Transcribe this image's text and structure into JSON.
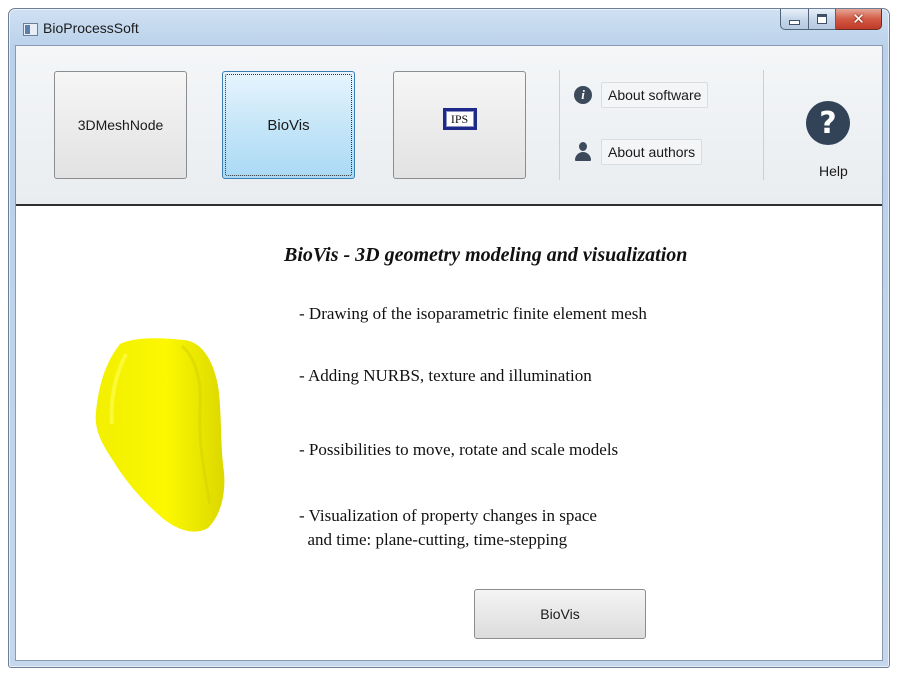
{
  "window": {
    "title": "BioProcessSoft"
  },
  "toolbar": {
    "mesh_label": "3DMeshNode",
    "biovis_label": "BioVis",
    "ips_logo_text": "IPS",
    "about_software_label": "About software",
    "about_authors_label": "About authors",
    "help_label": "Help",
    "help_glyph": "?"
  },
  "content": {
    "headline": "BioVis - 3D geometry modeling and visualization",
    "features": [
      "- Drawing of the isoparametric finite element mesh",
      "- Adding NURBS, texture and illumination",
      "- Possibilities to move, rotate and scale models",
      "- Visualization of property changes in space",
      "  and time: plane-cutting, time-stepping"
    ],
    "launch_button_label": "BioVis"
  },
  "colors": {
    "model_fill": "#f5f200",
    "active_tab": "#c6e6f8",
    "close_button": "#c9432f"
  },
  "icons": {
    "info": "info-icon",
    "authors": "person-icon",
    "help": "question-icon"
  }
}
